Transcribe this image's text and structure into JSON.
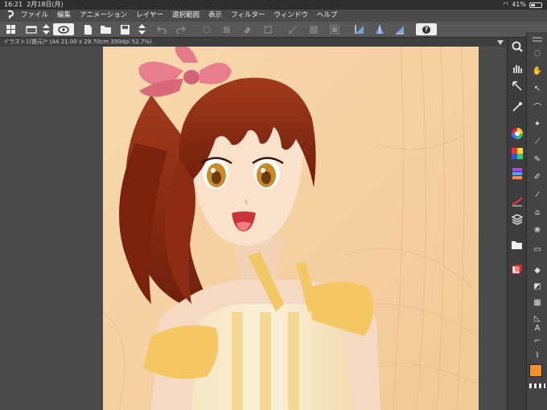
{
  "status": {
    "time": "16:21",
    "date": "2月18日(月)",
    "battery": "41%"
  },
  "menu": [
    "ファイル",
    "編集",
    "アニメーション",
    "レイヤー",
    "選択範囲",
    "表示",
    "フィルター",
    "ウィンドウ",
    "ヘルプ"
  ],
  "app_logo": "clip-studio-logo",
  "help_label": "?",
  "document_tab": "イラスト1(復元)* (A4 21.00 x 29.70cm 350dpi 52.7%)",
  "colors": {
    "canvas_bg": "#f6d4a6",
    "hair": "#8a2a12",
    "bow": "#e77a8a",
    "main_color": "#f0902a",
    "sub_color": "#d9a48a"
  },
  "icons": [
    "grid-icon",
    "command-bar-icon",
    "undo-icon",
    "redo-icon",
    "zoom-icon",
    "hand-icon",
    "pen-icon",
    "brush-icon",
    "color-wheel-icon",
    "layer-icon"
  ]
}
